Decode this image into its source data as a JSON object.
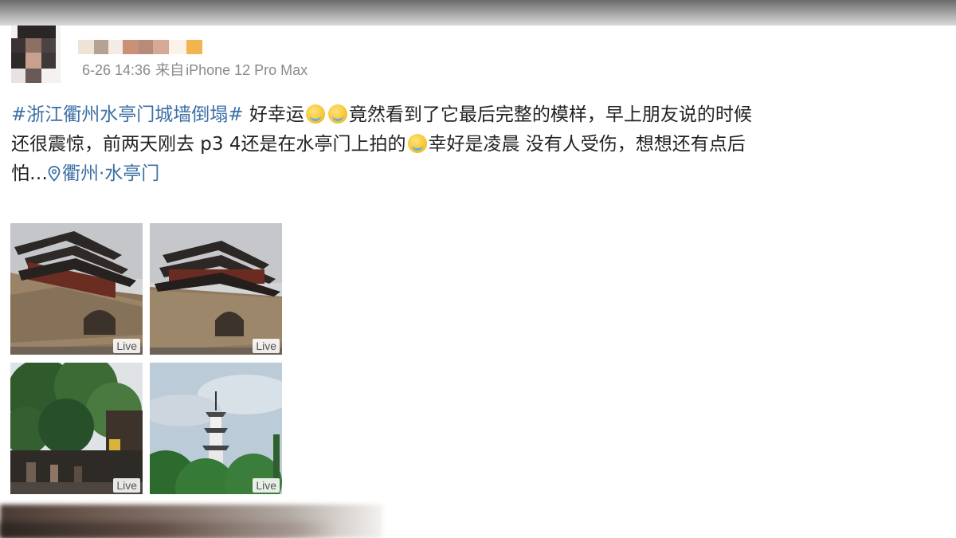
{
  "post": {
    "meta": {
      "time": "6-26 14:36",
      "source_prefix": "来自",
      "device": "iPhone 12 Pro Max"
    },
    "hashtag": "#浙江衢州水亭门城墙倒塌#",
    "line1_a": " 好幸运",
    "line1_b": "竟然看到了它最后完整的模样，早上朋友说的时候",
    "line2_a": "还很震惊，前两天刚去 p3 4还是在水亭门上拍的",
    "line2_b": "幸好是凌晨 没有人受伤，想想还有点后",
    "line3_a": "怕…",
    "location": "衢州·水亭门",
    "emojis": [
      "crying-face",
      "crying-face",
      "crying-face"
    ],
    "photos": [
      {
        "badge": "Live",
        "subject": "city-gate-tower"
      },
      {
        "badge": "Live",
        "subject": "city-gate-tower"
      },
      {
        "badge": "Live",
        "subject": "trees-street"
      },
      {
        "badge": "Live",
        "subject": "pagoda-sky"
      }
    ]
  },
  "colors": {
    "link": "#3d6fa6",
    "text": "#222222",
    "meta": "#8a8a8a"
  }
}
